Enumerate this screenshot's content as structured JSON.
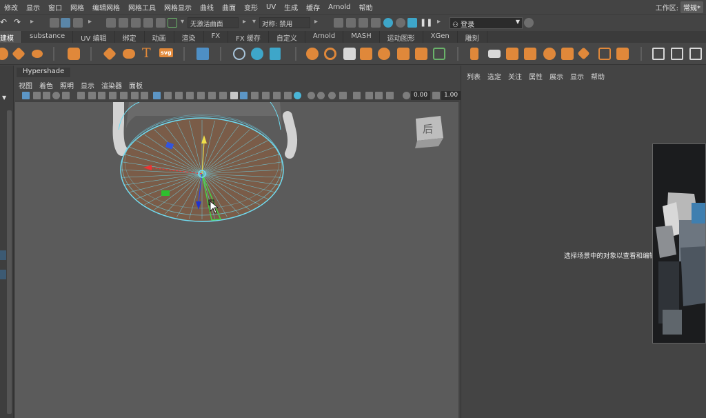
{
  "menubar": {
    "items": [
      "修改",
      "显示",
      "窗口",
      "网格",
      "编辑网格",
      "网格工具",
      "网格显示",
      "曲线",
      "曲面",
      "变形",
      "UV",
      "生成",
      "缓存",
      "Arnold",
      "帮助"
    ],
    "workspace_label": "工作区:",
    "workspace_value": "常规*"
  },
  "statusline": {
    "live_surface": "无激活曲面",
    "symmetry": "对称: 禁用",
    "login": "登录"
  },
  "shelf": {
    "tabs": [
      "建模",
      "substance",
      "UV 编辑",
      "绑定",
      "动画",
      "渲染",
      "FX",
      "FX 缓存",
      "自定义",
      "Arnold",
      "MASH",
      "运动图形",
      "XGen",
      "雕刻"
    ],
    "active_tab": "建模",
    "text_tool": "T",
    "svg_tool": "svg"
  },
  "panel": {
    "hypershade_tab": "Hypershade",
    "menus": [
      "视图",
      "着色",
      "照明",
      "显示",
      "渲染器",
      "面板"
    ],
    "field_a": "0.00",
    "field_b": "1.00",
    "viewcube_label": "后"
  },
  "attribute_editor": {
    "menus": [
      "列表",
      "选定",
      "关注",
      "属性",
      "展示",
      "显示",
      "帮助"
    ],
    "message": "选择场景中的对象以查看和编辑"
  },
  "colors": {
    "accent_orange": "#e0883a",
    "selection_cyan": "#6fdcf2",
    "viewport_bg": "#5b5b5b",
    "panel_bg": "#444444"
  }
}
